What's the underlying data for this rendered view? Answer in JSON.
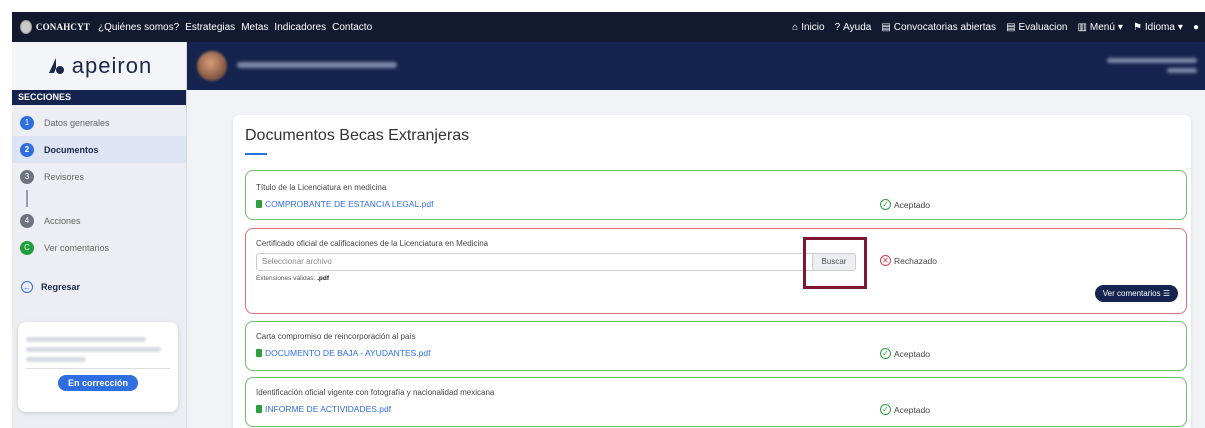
{
  "topnav": {
    "brand": "CONAHCYT",
    "links": [
      "¿Quiénes somos?",
      "Estrategias",
      "Metas",
      "Indicadores",
      "Contacto"
    ],
    "right": [
      {
        "icon": "home-icon",
        "label": "Inicio"
      },
      {
        "icon": "help-icon",
        "label": "Ayuda"
      },
      {
        "icon": "document-icon",
        "label": "Convocatorias abiertas"
      },
      {
        "icon": "document-icon",
        "label": "Evaluacion"
      },
      {
        "icon": "menu-icon",
        "label": "Menú"
      },
      {
        "icon": "flag-icon",
        "label": "Idioma"
      }
    ]
  },
  "sidebar": {
    "logo_text": "apeiron",
    "section_header": "SECCIONES",
    "steps": [
      {
        "num": "1",
        "label": "Datos generales",
        "color": "blue"
      },
      {
        "num": "2",
        "label": "Documentos",
        "color": "blue",
        "active": true
      },
      {
        "num": "3",
        "label": "Revisores",
        "color": "gray"
      },
      {
        "num": "4",
        "label": "Acciones",
        "color": "gray"
      },
      {
        "num": "C",
        "label": "Ver comentarios",
        "color": "green"
      }
    ],
    "back_label": "Regresar",
    "status_badge": "En corrección"
  },
  "main": {
    "title": "Documentos Becas Extranjeras",
    "documents": [
      {
        "label": "Título de la Licenciatura en medicina",
        "file": "COMPROBANTE DE ESTANCIA LEGAL.pdf",
        "status": "Aceptado"
      },
      {
        "label": "Certificado oficial de calificaciones de la Licenciatura en Medicina",
        "placeholder": "Seleccionar archivo",
        "button": "Buscar",
        "extensions_prefix": "Extensiones válidas:",
        "extensions": ".pdf",
        "status": "Rechazado",
        "comments_button": "Ver comentarios"
      },
      {
        "label": "Carta compromiso de reincorporación al país",
        "file": "DOCUMENTO DE BAJA - AYUDANTES.pdf",
        "status": "Aceptado"
      },
      {
        "label": "Identificación oficial vigente con fotografía y nacionalidad mexicana",
        "file": "INFORME DE ACTIVIDADES.pdf",
        "status": "Aceptado"
      }
    ]
  },
  "colors": {
    "nav": "#111a2e",
    "header": "#15244e",
    "accent": "#2f6ee0",
    "accepted": "#6dc06b",
    "rejected": "#e07178",
    "highlight": "#7c1832"
  }
}
